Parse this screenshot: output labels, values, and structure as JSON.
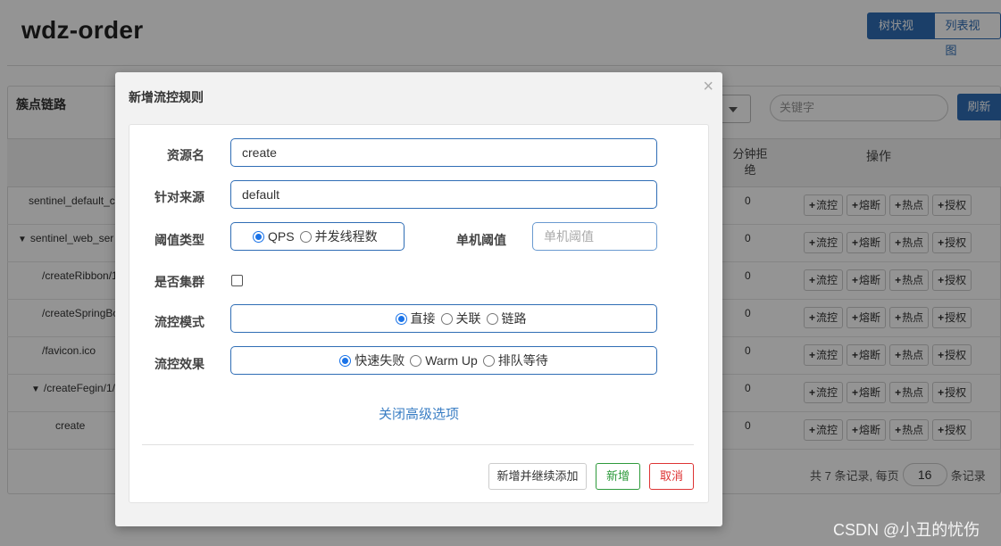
{
  "app": {
    "title": "wdz-order"
  },
  "view_toggle": {
    "tree": "树状视图",
    "list": "列表视图"
  },
  "panel": {
    "title": "簇点链路",
    "search_placeholder": "关键字",
    "refresh": "刷新"
  },
  "table": {
    "col_reject": "分钟拒绝",
    "col_ops": "操作",
    "op_labels": [
      "流控",
      "熔断",
      "热点",
      "授权"
    ],
    "rows": [
      {
        "resource": "sentinel_default_c",
        "tri": "",
        "indent": 24,
        "value": "0"
      },
      {
        "resource": "sentinel_web_ser",
        "tri": "▼",
        "indent": 12,
        "value": "0"
      },
      {
        "resource": "/createRibbon/1",
        "tri": "",
        "indent": 39,
        "value": "0"
      },
      {
        "resource": "/createSpringBo",
        "tri": "",
        "indent": 39,
        "value": "0"
      },
      {
        "resource": "/favicon.ico",
        "tri": "",
        "indent": 39,
        "value": "0"
      },
      {
        "resource": "/createFegin/1/",
        "tri": "▼",
        "indent": 27,
        "value": "0"
      },
      {
        "resource": "create",
        "tri": "",
        "indent": 54,
        "value": "0"
      }
    ]
  },
  "pager": {
    "prefix": "共 7 条记录, 每页",
    "page_size": "16",
    "suffix": "条记录"
  },
  "modal": {
    "title": "新增流控规则",
    "close": "×",
    "resource_label": "资源名",
    "resource_value": "create",
    "origin_label": "针对来源",
    "origin_value": "default",
    "threshold_type_label": "阈值类型",
    "threshold_type_options": [
      {
        "label": "QPS",
        "selected": true
      },
      {
        "label": "并发线程数",
        "selected": false
      }
    ],
    "single_threshold_label": "单机阈值",
    "single_threshold_placeholder": "单机阈值",
    "cluster_label": "是否集群",
    "cluster_checked": false,
    "mode_label": "流控模式",
    "mode_options": [
      {
        "label": "直接",
        "selected": true
      },
      {
        "label": "关联",
        "selected": false
      },
      {
        "label": "链路",
        "selected": false
      }
    ],
    "effect_label": "流控效果",
    "effect_options": [
      {
        "label": "快速失败",
        "selected": true
      },
      {
        "label": "Warm Up",
        "selected": false
      },
      {
        "label": "排队等待",
        "selected": false
      }
    ],
    "advanced_link": "关闭高级选项",
    "btn_continue": "新增并继续添加",
    "btn_add": "新增",
    "btn_cancel": "取消"
  },
  "watermark": "CSDN @小丑的忧伤"
}
